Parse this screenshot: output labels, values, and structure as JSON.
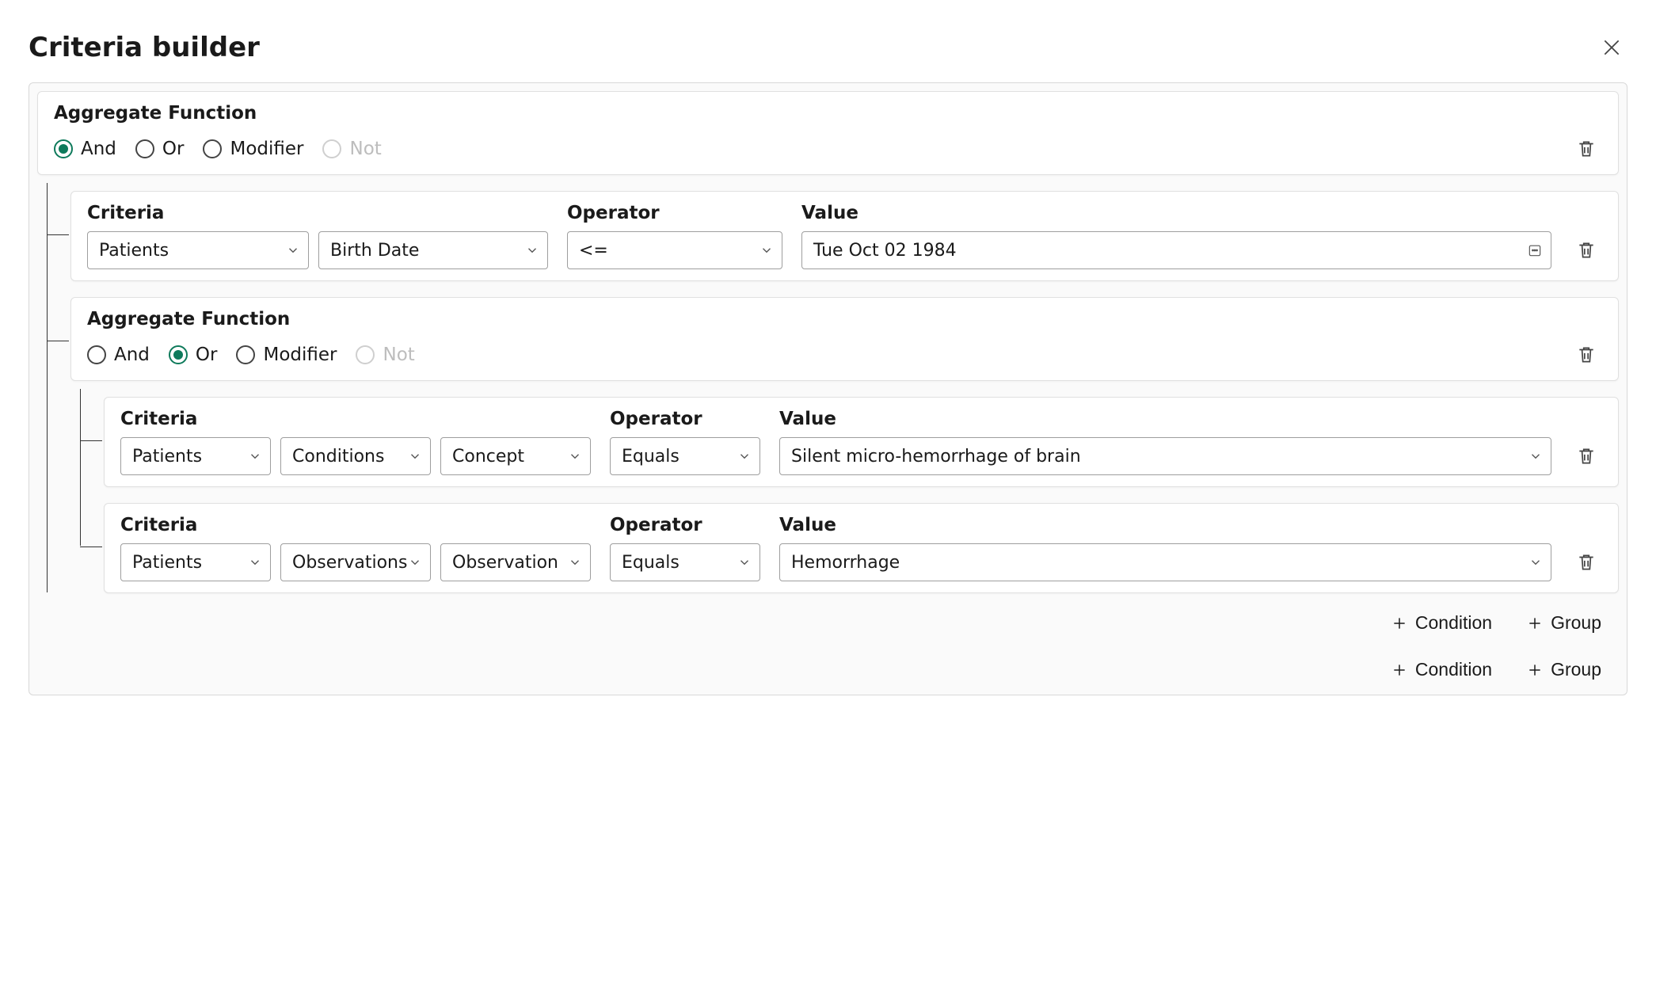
{
  "header": {
    "title": "Criteria builder"
  },
  "labels": {
    "aggregate_function": "Aggregate Function",
    "criteria": "Criteria",
    "operator": "Operator",
    "value": "Value",
    "add_condition": "Condition",
    "add_group": "Group"
  },
  "agg_options": {
    "and": "And",
    "or": "Or",
    "modifier": "Modifier",
    "not": "Not"
  },
  "group1": {
    "selected": "and",
    "row1": {
      "criteria1": "Patients",
      "criteria2": "Birth Date",
      "operator": "<=",
      "value": "Tue Oct 02 1984"
    },
    "group2": {
      "selected": "or",
      "row1": {
        "criteria1": "Patients",
        "criteria2": "Conditions",
        "criteria3": "Concept",
        "operator": "Equals",
        "value": "Silent micro-hemorrhage of brain"
      },
      "row2": {
        "criteria1": "Patients",
        "criteria2": "Observations",
        "criteria3": "Observation",
        "operator": "Equals",
        "value": "Hemorrhage"
      }
    }
  }
}
